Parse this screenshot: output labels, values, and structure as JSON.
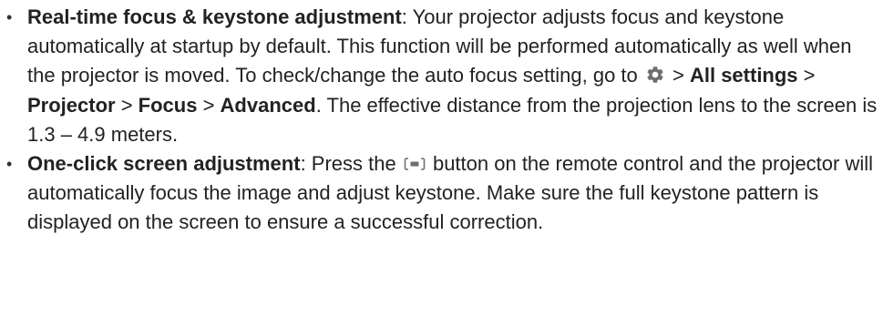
{
  "list": {
    "items": [
      {
        "bullet": "•",
        "title": "Real-time focus & keystone adjustment",
        "text_1": ": Your projector adjusts focus and keystone automatically at startup by default. This function will be performed automatically as well when the projector is moved. To check/change the auto focus setting, go to ",
        "icon": "gear-icon",
        "sep_1": " > ",
        "menu_1": "All settings",
        "sep_2": " > ",
        "menu_2": "Projector",
        "sep_3": " > ",
        "menu_3": "Focus",
        "sep_4": " > ",
        "menu_4": "Advanced",
        "text_2": ". The effective distance from the projection lens to the screen is 1.3 – 4.9 meters."
      },
      {
        "bullet": "•",
        "title": "One-click screen adjustment",
        "text_1": ": Press the ",
        "icon": "screen-adjust-icon",
        "text_2": " button on the remote control and the projector will automatically focus the image and adjust keystone. Make sure the full keystone pattern is displayed on the screen to ensure a successful correction."
      }
    ]
  }
}
